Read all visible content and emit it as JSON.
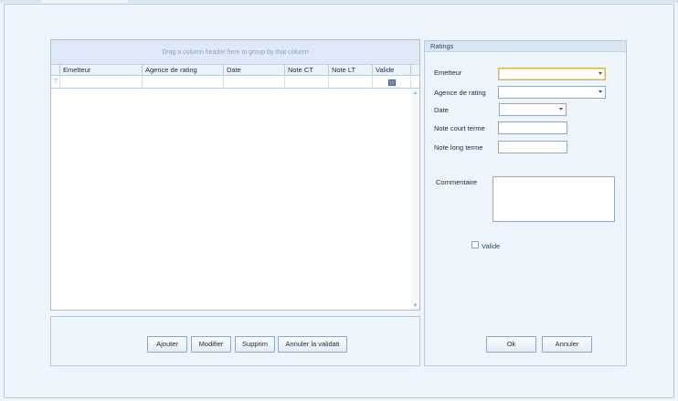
{
  "grid": {
    "group_hint": "Drag a column header here to group by that column",
    "columns": [
      "Emetteur",
      "Agence de rating",
      "Date",
      "Note CT",
      "Note LT",
      "Valide"
    ]
  },
  "buttons": {
    "ajouter": "Ajouter",
    "modifier": "Modifier",
    "supprimer": "Supprim",
    "annuler_validation": "Annuler la validati"
  },
  "ratings": {
    "title": "Ratings",
    "labels": {
      "emetteur": "Emetteur",
      "agence": "Agence de rating",
      "date": "Date",
      "note_ct": "Note court terme",
      "note_lt": "Note long terme",
      "commentaire": "Commentaire",
      "valide": "Valide"
    },
    "values": {
      "emetteur": "",
      "agence": "",
      "date": "",
      "note_ct": "",
      "note_lt": "",
      "commentaire": ""
    },
    "ok": "Ok",
    "annuler": "Annuler"
  },
  "icons": {
    "filter": "filter-icon",
    "dropdown": "chevron-down-icon"
  },
  "colors": {
    "focus_border": "#d7b24a",
    "accent": "#6a8fbb"
  }
}
